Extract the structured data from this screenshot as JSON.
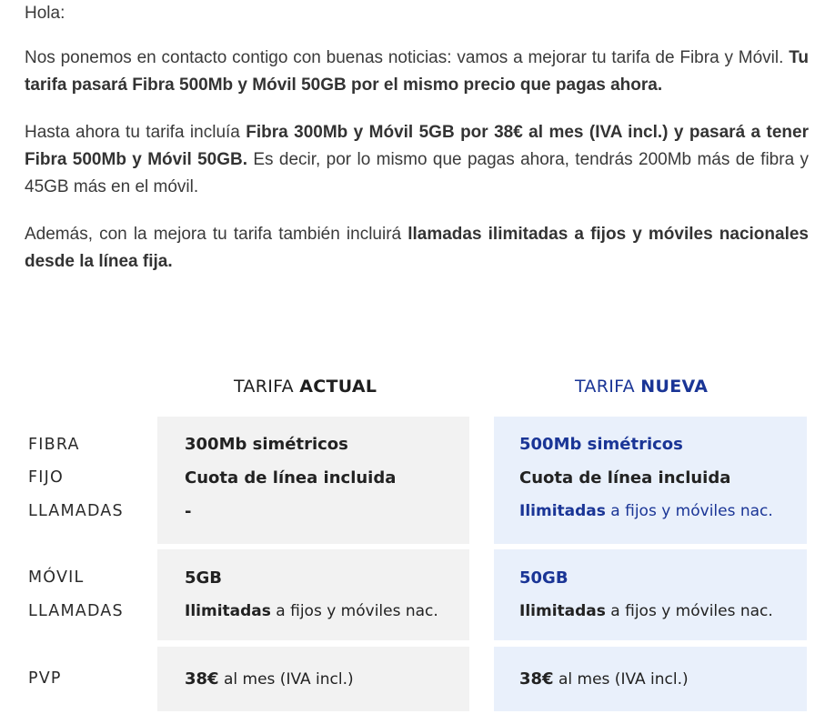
{
  "email": {
    "greeting": "Hola:",
    "p1_a": "Nos ponemos en contacto contigo con buenas noticias: vamos a mejorar tu tarifa de Fibra y Móvil. ",
    "p1_b": "Tu tarifa pasará Fibra 500Mb y Móvil 50GB por el mismo precio que pagas ahora.",
    "p2_a": "Hasta ahora tu tarifa incluía ",
    "p2_b": "Fibra 300Mb y Móvil 5GB por 38€ al mes (IVA incl.) y pasará a tener Fibra 500Mb y Móvil 50GB.",
    "p2_c": " Es decir, por lo mismo que pagas ahora, tendrás 200Mb más de fibra y 45GB más en el móvil.",
    "p3_a": "Además, con la mejora tu tarifa también incluirá ",
    "p3_b": "llamadas ilimitadas a fijos y móviles nacionales desde la línea fija."
  },
  "comparison": {
    "header_actual_prefix": "TARIFA ",
    "header_actual_bold": "ACTUAL",
    "header_nueva_prefix": "TARIFA ",
    "header_nueva_bold": "NUEVA",
    "labels": {
      "fibra": "FIBRA",
      "fijo": "FIJO",
      "llamadas_fijo": "LLAMADAS",
      "movil": "MÓVIL",
      "llamadas_movil": "LLAMADAS",
      "pvp": "PVP"
    },
    "actual": {
      "fibra": "300Mb simétricos",
      "fijo": "Cuota de línea incluida",
      "llamadas_fijo": "-",
      "movil": "5GB",
      "llamadas_movil_bold": "Ilimitadas",
      "llamadas_movil_rest": " a fijos y móviles nac.",
      "pvp_bold": "38€",
      "pvp_rest": "  al mes (IVA incl.)"
    },
    "nueva": {
      "fibra": "500Mb simétricos",
      "fijo": "Cuota de línea incluida",
      "llamadas_fijo_bold": "Ilimitadas",
      "llamadas_fijo_rest": " a fijos y móviles nac.",
      "movil": "50GB",
      "llamadas_movil_bold": "Ilimitadas",
      "llamadas_movil_rest": " a fijos y móviles nac.",
      "pvp_bold": "38€",
      "pvp_rest": "  al mes (IVA incl.)"
    }
  },
  "colors": {
    "accent_blue": "#1a3596",
    "actual_bg": "#f2f2f2",
    "nueva_bg": "#e9f0fb"
  }
}
